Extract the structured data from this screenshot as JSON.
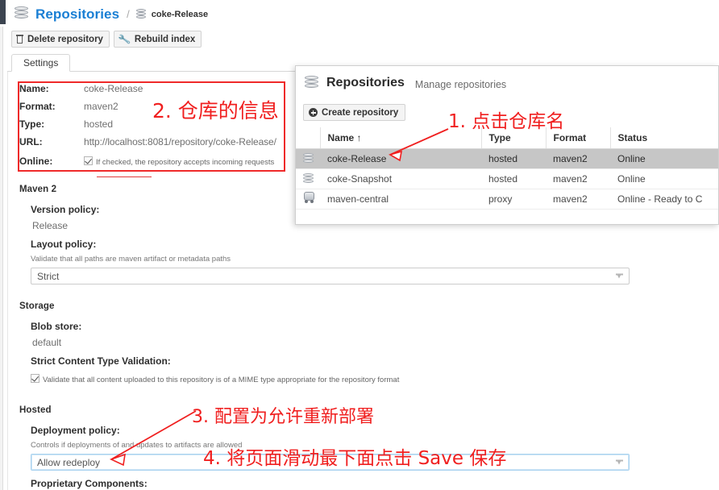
{
  "breadcrumb": {
    "root_icon": "database-icon",
    "root": "Repositories",
    "separator": "/",
    "child_icon": "database-icon",
    "child": "coke-Release"
  },
  "toolbar": {
    "delete_icon": "trash-icon",
    "delete_label": "Delete repository",
    "rebuild_icon": "wrench-icon",
    "rebuild_label": "Rebuild index"
  },
  "tabs": [
    {
      "label": "Settings",
      "active": true
    }
  ],
  "settings": {
    "info": {
      "rows": [
        {
          "key": "Name:",
          "value": "coke-Release"
        },
        {
          "key": "Format:",
          "value": "maven2"
        },
        {
          "key": "Type:",
          "value": "hosted"
        },
        {
          "key": "URL:",
          "value": "http://localhost:8081/repository/coke-Release/"
        }
      ],
      "online_key": "Online:",
      "online_checked": true,
      "online_text": "If checked, the repository accepts incoming requests"
    },
    "maven": {
      "group_title": "Maven 2",
      "version_policy_label": "Version policy:",
      "version_policy_value": "Release",
      "layout_policy_label": "Layout policy:",
      "layout_policy_hint": "Validate that all paths are maven artifact or metadata paths",
      "layout_policy_value": "Strict"
    },
    "storage": {
      "group_title": "Storage",
      "blob_store_label": "Blob store:",
      "blob_store_value": "default",
      "strict_label": "Strict Content Type Validation:",
      "strict_checked": true,
      "strict_text": "Validate that all content uploaded to this repository is of a MIME type appropriate for the repository format"
    },
    "hosted": {
      "group_title": "Hosted",
      "deployment_label": "Deployment policy:",
      "deployment_hint": "Controls if deployments of and updates to artifacts are allowed",
      "deployment_value": "Allow redeploy",
      "proprietary_label": "Proprietary Components:"
    }
  },
  "popup": {
    "icon": "database-icon",
    "title": "Repositories",
    "subtitle": "Manage repositories",
    "create_icon": "plus-circle-icon",
    "create_label": "Create repository",
    "columns": [
      "",
      "Name ↑",
      "Type",
      "Format",
      "Status"
    ],
    "rows": [
      {
        "icon": "database-icon",
        "name": "coke-Release",
        "type": "hosted",
        "format": "maven2",
        "status": "Online",
        "selected": true
      },
      {
        "icon": "database-icon",
        "name": "coke-Snapshot",
        "type": "hosted",
        "format": "maven2",
        "status": "Online",
        "selected": false
      },
      {
        "icon": "proxy-icon",
        "name": "maven-central",
        "type": "proxy",
        "format": "maven2",
        "status": "Online - Ready to C",
        "selected": false
      }
    ]
  },
  "annotations": {
    "accent_color": "#f01f1f",
    "items": [
      {
        "id": "step-1",
        "text": "1. 点击仓库名"
      },
      {
        "id": "step-2",
        "text": "2. 仓库的信息"
      },
      {
        "id": "step-3",
        "text": "3. 配置为允许重新部署"
      },
      {
        "id": "step-4",
        "text": "4. 将页面滑动最下面点击 Save 保存"
      }
    ]
  }
}
